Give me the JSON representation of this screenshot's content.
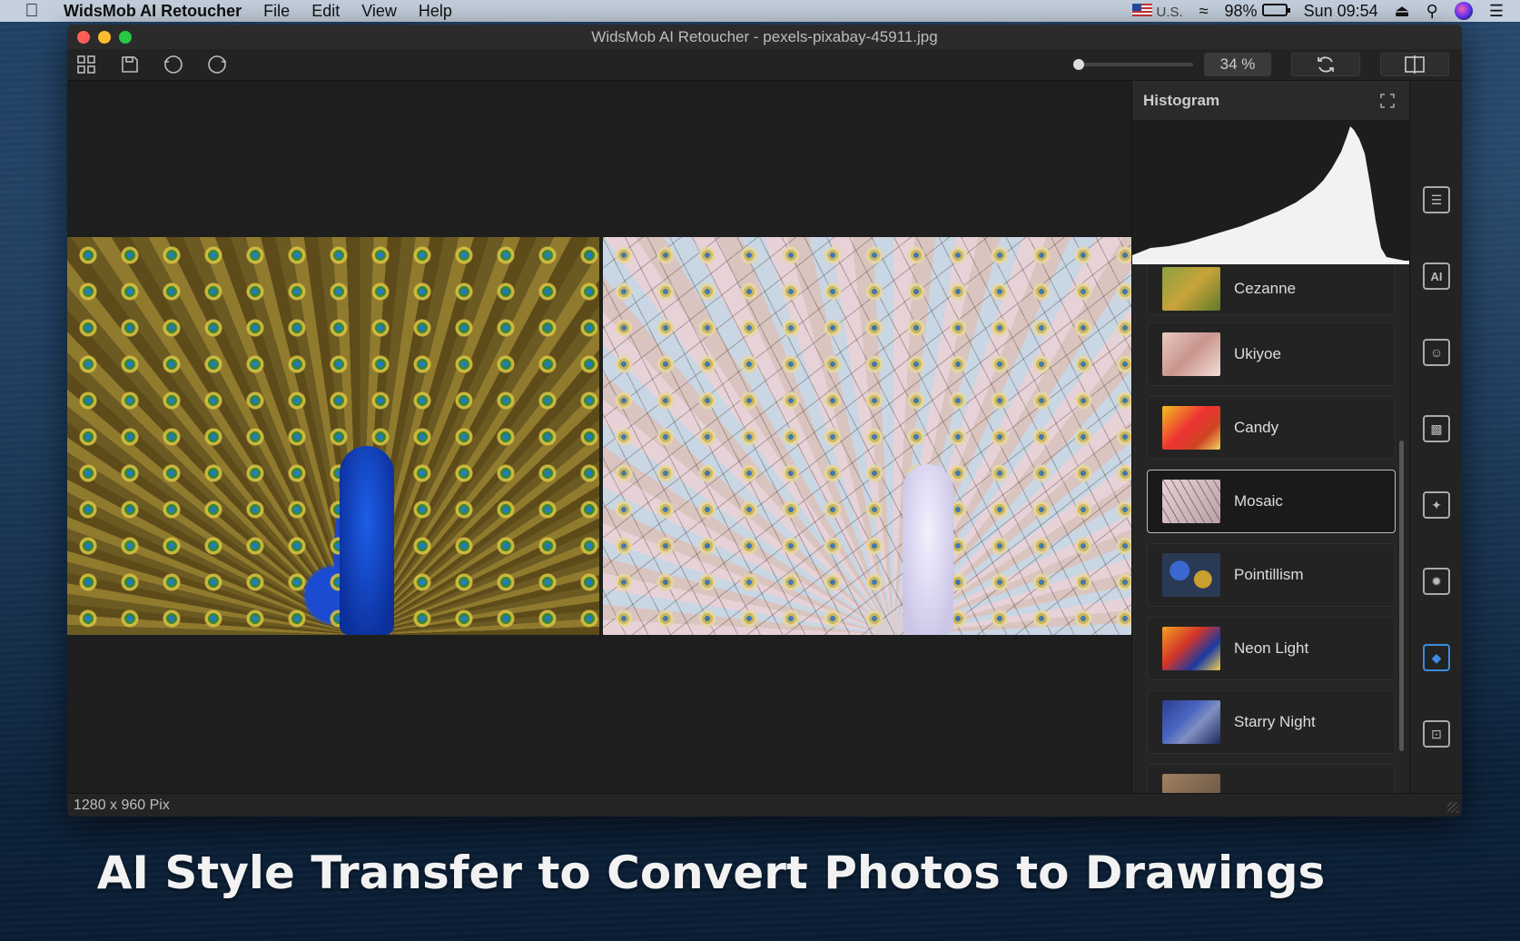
{
  "menubar": {
    "app_name": "WidsMob AI Retoucher",
    "menus": [
      "File",
      "Edit",
      "View",
      "Help"
    ],
    "input_source": "U.S.",
    "battery": "98%",
    "clock": "Sun 09:54"
  },
  "window": {
    "title": "WidsMob AI Retoucher - pexels-pixabay-45911.jpg",
    "zoom": "34 %",
    "zoom_level": 0.0,
    "status": "1280 x 960 Pix"
  },
  "panel": {
    "histogram_title": "Histogram",
    "styles": [
      {
        "label": "Cezanne",
        "selected": false
      },
      {
        "label": "Ukiyoe",
        "selected": false
      },
      {
        "label": "Candy",
        "selected": false
      },
      {
        "label": "Mosaic",
        "selected": true
      },
      {
        "label": "Pointillism",
        "selected": false
      },
      {
        "label": "Neon Light",
        "selected": false
      },
      {
        "label": "Starry Night",
        "selected": false
      }
    ]
  },
  "side_tools": [
    {
      "icon": "adjust-sliders-icon"
    },
    {
      "icon": "ai-icon"
    },
    {
      "icon": "portrait-icon"
    },
    {
      "icon": "noise-icon"
    },
    {
      "icon": "magic-wand-icon"
    },
    {
      "icon": "lens-icon"
    },
    {
      "icon": "style-transfer-icon",
      "active": true
    },
    {
      "icon": "crop-icon"
    }
  ],
  "caption": "AI Style Transfer to Convert Photos to Drawings"
}
